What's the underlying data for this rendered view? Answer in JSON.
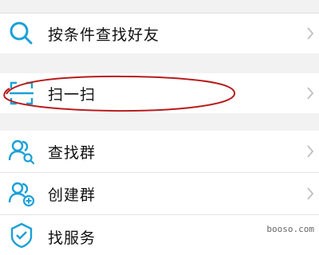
{
  "menu": {
    "items": [
      {
        "label": "按条件查找好友",
        "icon": "search-icon"
      },
      {
        "label": "扫一扫",
        "icon": "scan-icon"
      },
      {
        "label": "查找群",
        "icon": "find-group-icon"
      },
      {
        "label": "创建群",
        "icon": "create-group-icon"
      },
      {
        "label": "找服务",
        "icon": "find-service-icon"
      }
    ]
  },
  "colors": {
    "accent": "#1aa0d8",
    "annotation": "#b81c1c",
    "chevron": "#b8b8b8",
    "background": "#f2f2f2"
  },
  "watermark": {
    "text": "booso.com"
  }
}
